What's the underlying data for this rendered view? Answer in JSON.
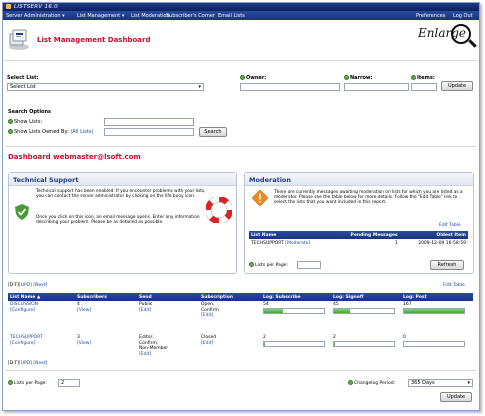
{
  "app": {
    "title": "LISTSERV 16.0"
  },
  "menu": {
    "items": [
      "Server Administration ▾",
      "List Management ▾",
      "List Moderation",
      "Subscriber's Corner",
      "Email Lists"
    ],
    "right": [
      "Preferences",
      "Log Out"
    ]
  },
  "header": {
    "title": "List Management Dashboard",
    "enlarge": "Enlarge"
  },
  "select": {
    "select_list_label": "Select List:",
    "select_list_value": "Select List",
    "owner_label": "Owner:",
    "narrow_label": "Narrow:",
    "items_label": "Items:",
    "update_button": "Update"
  },
  "search": {
    "title": "Search Options",
    "show_lists_label": "Show Lists:",
    "owned_by_label": "Show Lists Owned By:",
    "all_lists_link": "(All Lists)",
    "search_button": "Search"
  },
  "dashboard": {
    "title": "Dashboard webmaster@lsoft.com"
  },
  "support": {
    "title": "Technical Support",
    "text1": "Technical support has been enabled. If you encounter problems with your lists, you can contact the server administrator by clicking on the life buoy icon.",
    "text2": "Once you click on this icon, an email message opens. Enter any information describing your problem. Please be as detailed as possible."
  },
  "moderation": {
    "title": "Moderation",
    "text": "There are currently messages awaiting moderation on lists for which you are listed as a moderator. Please see the table below for more details. Follow the \"Edit Table\" link to select the lists that you want included in this report.",
    "edit_table": "Edit Table",
    "columns": [
      "List Name",
      "Pending Messages",
      "Oldest Item"
    ],
    "rows": [
      {
        "name": "TECHSUPPORT",
        "link": "[Moderate]",
        "pending": "1",
        "oldest": "2009-12-09 16:58:59"
      }
    ],
    "lists_per_page_label": "Lists per Page:",
    "refresh_button": "Refresh"
  },
  "lists": {
    "pager": [
      "[D-T]",
      "[UPD]",
      "[Next]"
    ],
    "edit_table": "Edit Table",
    "columns": [
      "List Name ▲",
      "Subscribers",
      "Send",
      "Subscription",
      "Log: Subscribe",
      "Log: Signoff",
      "Log: Post"
    ],
    "rows": [
      {
        "name": "DISCUSSION",
        "configure": "[Configure]",
        "subscribers": "4",
        "view": "[View]",
        "send": [
          "Public"
        ],
        "send_edit": "[Edit]",
        "subscription": [
          "Open,",
          "Confirm"
        ],
        "sub_edit": "[Edit]",
        "subscribe": "54",
        "signoff": "45",
        "post": "167",
        "subscribe_level": 0.32,
        "signoff_level": 0.27,
        "post_level": 1.0
      },
      {
        "name": "TECHSUPPORT",
        "configure": "[Configure]",
        "subscribers": "3",
        "view": "[View]",
        "send": [
          "Editor,",
          "Confirm,",
          "Non-Member"
        ],
        "send_edit": "[Edit]",
        "subscription": [
          "Closed"
        ],
        "sub_edit": "[Edit]",
        "subscribe": "2",
        "signoff": "2",
        "post": "0",
        "subscribe_level": 0.01,
        "signoff_level": 0.01,
        "post_level": 0.0
      }
    ],
    "lists_per_page_label": "Lists per Page:",
    "lists_per_page_value": "2",
    "period_label": "Changelog Period:",
    "period_value": "365 Days",
    "update_button": "Update"
  },
  "colors": {
    "accent": "#c8102e",
    "nav": "#16347e",
    "bar": "#3aa83a"
  }
}
